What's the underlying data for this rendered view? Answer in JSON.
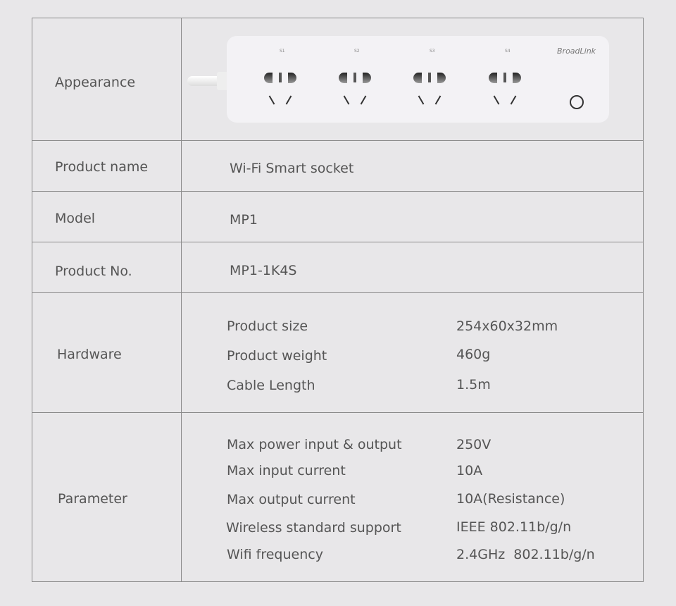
{
  "appearance": {
    "label": "Appearance",
    "socket_labels": [
      "S1",
      "S2",
      "S3",
      "S4"
    ],
    "brand": "BroadLink"
  },
  "product_name": {
    "label": "Product name",
    "value": "Wi-Fi Smart socket"
  },
  "model": {
    "label": "Model",
    "value": "MP1"
  },
  "product_no": {
    "label": "Product No.",
    "value": "MP1-1K4S"
  },
  "hardware": {
    "label": "Hardware",
    "items": [
      {
        "k": "Product size",
        "v": "254x60x32mm"
      },
      {
        "k": "Product weight",
        "v": "460g"
      },
      {
        "k": "Cable Length",
        "v": "1.5m"
      }
    ]
  },
  "parameter": {
    "label": "Parameter",
    "items": [
      {
        "k": "Max power input & output",
        "v": "250V"
      },
      {
        "k": "Max input current",
        "v": "10A"
      },
      {
        "k": "Max output current",
        "v": "10A(Resistance)"
      },
      {
        "k": "Wireless standard support",
        "v": "IEEE 802.11b/g/n"
      },
      {
        "k": "Wifi frequency",
        "v": "2.4GHz  802.11b/g/n"
      }
    ]
  }
}
